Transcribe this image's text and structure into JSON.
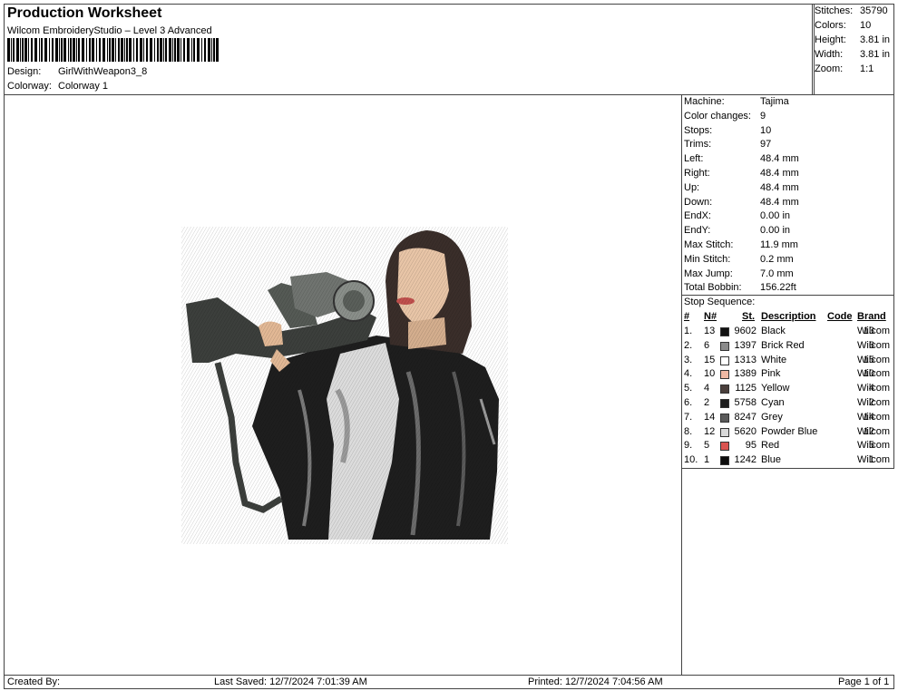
{
  "header": {
    "title": "Production Worksheet",
    "subtitle": "Wilcom EmbroideryStudio – Level 3 Advanced",
    "design_label": "Design:",
    "design_value": "GirlWithWeapon3_8",
    "colorway_label": "Colorway:",
    "colorway_value": "Colorway 1"
  },
  "stats": [
    {
      "k": "Stitches:",
      "v": "35790"
    },
    {
      "k": "Colors:",
      "v": "10"
    },
    {
      "k": "Height:",
      "v": "3.81 in"
    },
    {
      "k": "Width:",
      "v": "3.81 in"
    },
    {
      "k": "Zoom:",
      "v": "1:1"
    }
  ],
  "machine": [
    {
      "k": "Machine:",
      "v": "Tajima"
    },
    {
      "k": "Color changes:",
      "v": "9"
    },
    {
      "k": "Stops:",
      "v": "10"
    },
    {
      "k": "Trims:",
      "v": "97"
    },
    {
      "k": "Left:",
      "v": "48.4 mm"
    },
    {
      "k": "Right:",
      "v": "48.4 mm"
    },
    {
      "k": "Up:",
      "v": "48.4 mm"
    },
    {
      "k": "Down:",
      "v": "48.4 mm"
    },
    {
      "k": "EndX:",
      "v": "0.00 in"
    },
    {
      "k": "EndY:",
      "v": "0.00 in"
    },
    {
      "k": "Max Stitch:",
      "v": "11.9 mm"
    },
    {
      "k": "Min Stitch:",
      "v": "0.2 mm"
    },
    {
      "k": "Max Jump:",
      "v": "7.0 mm"
    },
    {
      "k": "Total Bobbin:",
      "v": "156.22ft"
    }
  ],
  "stop_sequence": {
    "label": "Stop Sequence:",
    "headers": {
      "num": "#",
      "n": "N#",
      "st": "St.",
      "desc": "Description",
      "code": "Code",
      "brand": "Brand"
    },
    "rows": [
      {
        "num": "1.",
        "n": "13",
        "color": "#111111",
        "st": "9602",
        "desc": "Black",
        "code": "13",
        "brand": "Wilcom"
      },
      {
        "num": "2.",
        "n": "6",
        "color": "#8a8a8a",
        "st": "1397",
        "desc": "Brick Red",
        "code": "6",
        "brand": "Wilcom"
      },
      {
        "num": "3.",
        "n": "15",
        "color": "#ffffff",
        "st": "1313",
        "desc": "White",
        "code": "15",
        "brand": "Wilcom"
      },
      {
        "num": "4.",
        "n": "10",
        "color": "#efb9a4",
        "st": "1389",
        "desc": "Pink",
        "code": "10",
        "brand": "Wilcom"
      },
      {
        "num": "5.",
        "n": "4",
        "color": "#4a3f3c",
        "st": "1125",
        "desc": "Yellow",
        "code": "4",
        "brand": "Wilcom"
      },
      {
        "num": "6.",
        "n": "2",
        "color": "#1e1e1e",
        "st": "5758",
        "desc": "Cyan",
        "code": "2",
        "brand": "Wilcom"
      },
      {
        "num": "7.",
        "n": "14",
        "color": "#5a5a5a",
        "st": "8247",
        "desc": "Grey",
        "code": "14",
        "brand": "Wilcom"
      },
      {
        "num": "8.",
        "n": "12",
        "color": "#d9d9d9",
        "st": "5620",
        "desc": "Powder Blue",
        "code": "12",
        "brand": "Wilcom"
      },
      {
        "num": "9.",
        "n": "5",
        "color": "#d9534f",
        "st": "95",
        "desc": "Red",
        "code": "5",
        "brand": "Wilcom"
      },
      {
        "num": "10.",
        "n": "1",
        "color": "#0d0d0d",
        "st": "1242",
        "desc": "Blue",
        "code": "1",
        "brand": "Wilcom"
      }
    ]
  },
  "footer": {
    "created_by": "Created By:",
    "last_saved": "Last Saved: 12/7/2024 7:01:39 AM",
    "printed": "Printed: 12/7/2024 7:04:56 AM",
    "page": "Page 1 of 1"
  }
}
